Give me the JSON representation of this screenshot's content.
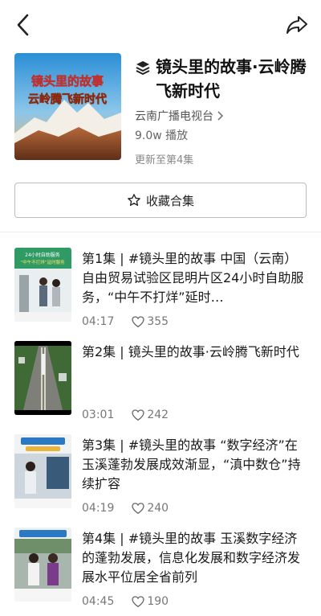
{
  "topbar": {
    "back_icon": "chevron-left-icon",
    "share_icon": "share-arrow-icon"
  },
  "collection": {
    "cover_text_line1": "镜头里的故事",
    "cover_text_line2": "云岭腾飞新时代",
    "title": "镜头里的故事·云岭腾飞新时代",
    "publisher": "云南广播电视台",
    "plays": "9.0w 播放",
    "updated": "更新至第4集"
  },
  "favorite_button": {
    "label": "收藏合集",
    "icon": "star-outline-icon"
  },
  "episodes": [
    {
      "title": "第1集 | #镜头里的故事 中国（云南）自由贸易试验区昆明片区24小时自助服务，“中午不打烊”延时…",
      "duration": "04:17",
      "likes": "355",
      "thumb_caption": "24小时自助服务\n“中午不打烊”延时服务"
    },
    {
      "title": "第2集 | 镜头里的故事·云岭腾飞新时代",
      "duration": "03:01",
      "likes": "242"
    },
    {
      "title": "第3集 | #镜头里的故事 “数字经济”在玉溪蓬勃发展成效渐显，“滇中数仓”持续扩容",
      "duration": "04:19",
      "likes": "240"
    },
    {
      "title": "第4集 | #镜头里的故事 玉溪数字经济的蓬勃发展，信息化发展和数字经济发展水平位居全省前列",
      "duration": "04:45",
      "likes": "190"
    }
  ],
  "colors": {
    "text": "#1a1a1a",
    "muted": "#777777",
    "border": "#bdbdbd",
    "divider": "#ececec"
  }
}
